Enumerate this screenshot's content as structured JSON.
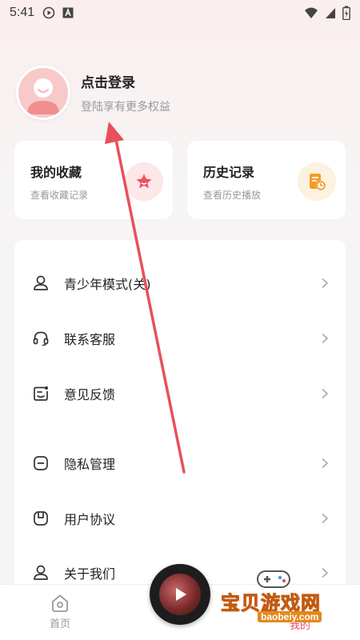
{
  "status_bar": {
    "time": "5:41",
    "icons": [
      "play-circle-icon",
      "font-a-icon",
      "wifi-icon",
      "signal-icon",
      "battery-icon"
    ]
  },
  "profile": {
    "title": "点击登录",
    "subtitle": "登陆享有更多权益"
  },
  "cards": [
    {
      "title": "我的收藏",
      "subtitle": "查看收藏记录",
      "icon": "star-icon",
      "color": "#f0505f"
    },
    {
      "title": "历史记录",
      "subtitle": "查看历史播放",
      "icon": "history-doc-icon",
      "color": "#f59a23"
    }
  ],
  "menu": {
    "items": [
      {
        "label": "青少年模式(关)",
        "icon": "teen-mode-icon"
      },
      {
        "label": "联系客服",
        "icon": "headset-icon"
      },
      {
        "label": "意见反馈",
        "icon": "feedback-icon"
      },
      {
        "label": "隐私管理",
        "icon": "privacy-icon"
      },
      {
        "label": "用户协议",
        "icon": "agreement-icon"
      },
      {
        "label": "关于我们",
        "icon": "about-icon"
      }
    ]
  },
  "tabbar": {
    "home_label": "首页",
    "mine_label": "我的",
    "active_color": "#e84c5b"
  },
  "watermark": {
    "text": "宝贝游戏网",
    "url": "baobeiy.com"
  },
  "colors": {
    "annotation_arrow": "#e8505b"
  }
}
